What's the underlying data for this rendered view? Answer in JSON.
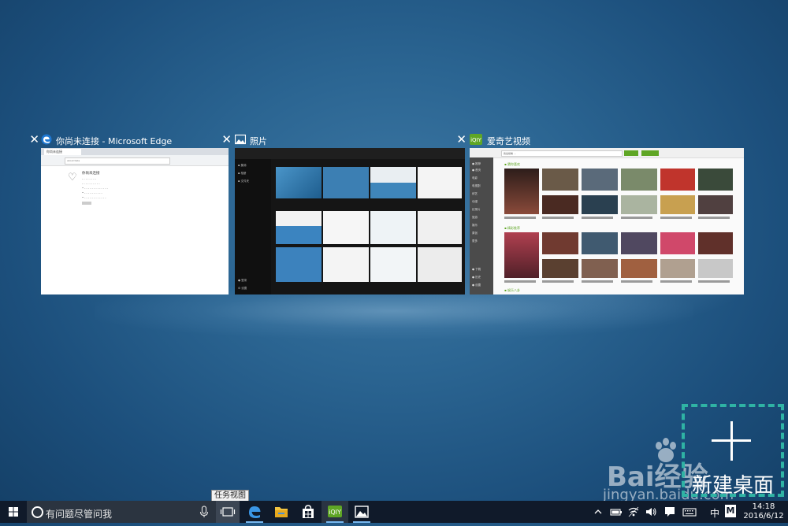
{
  "windows": [
    {
      "title": "你尚未连接 - Microsoft Edge",
      "app": "edge",
      "close": "✕"
    },
    {
      "title": "照片",
      "app": "photos",
      "close": "✕"
    },
    {
      "title": "爱奇艺视频",
      "app": "iqiyi",
      "close": "✕"
    }
  ],
  "new_desktop": {
    "label": "新建桌面",
    "icon": "plus-icon"
  },
  "taskbar": {
    "search_placeholder": "有问题尽管问我",
    "task_view_tooltip": "任务视图",
    "pinned_apps": [
      "edge",
      "file-explorer",
      "store",
      "iqiyi",
      "photos"
    ],
    "ime_label": "中",
    "ime_mode": "M",
    "time": "14:18",
    "date": "2016/6/12"
  },
  "watermark": {
    "brand": "Bai经验",
    "url": "jingyan.baidu.com"
  },
  "colors": {
    "accent": "#2fb3a4",
    "taskbar": "#101a2a",
    "iqiyi_green": "#5fa625"
  }
}
